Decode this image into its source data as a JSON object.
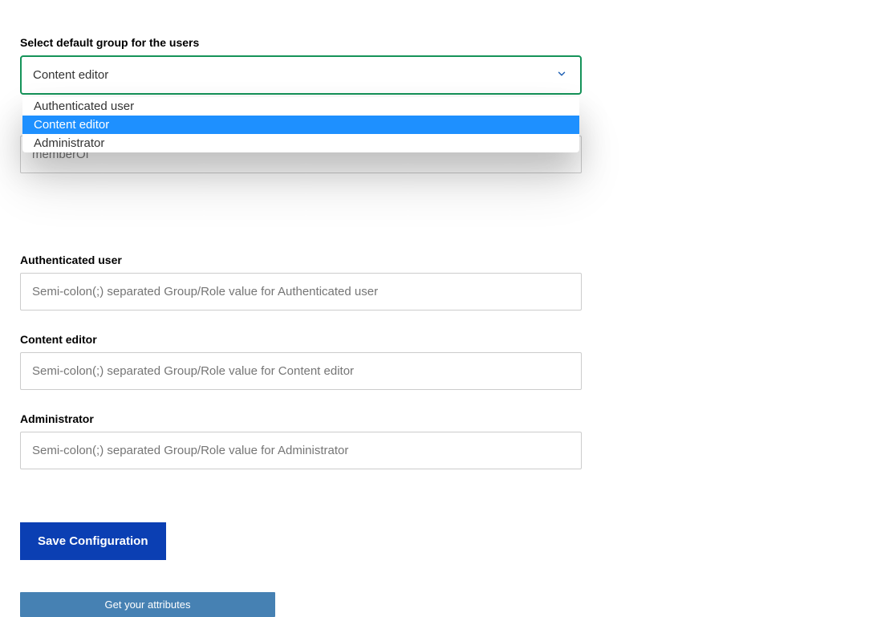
{
  "labels": {
    "default_group": "Select default group for the users",
    "authenticated_user": "Authenticated user",
    "content_editor": "Content editor",
    "administrator": "Administrator"
  },
  "select": {
    "selected": "Content editor",
    "options": {
      "0": "Authenticated user",
      "1": "Content editor",
      "2": "Administrator"
    }
  },
  "underlay": {
    "value": "memberOf"
  },
  "placeholders": {
    "authenticated_user": "Semi-colon(;) separated Group/Role value for Authenticated user",
    "content_editor": "Semi-colon(;) separated Group/Role value for Content editor",
    "administrator": "Semi-colon(;) separated Group/Role value for Administrator"
  },
  "buttons": {
    "save": "Save Configuration",
    "get_attributes": "Get your attributes"
  }
}
